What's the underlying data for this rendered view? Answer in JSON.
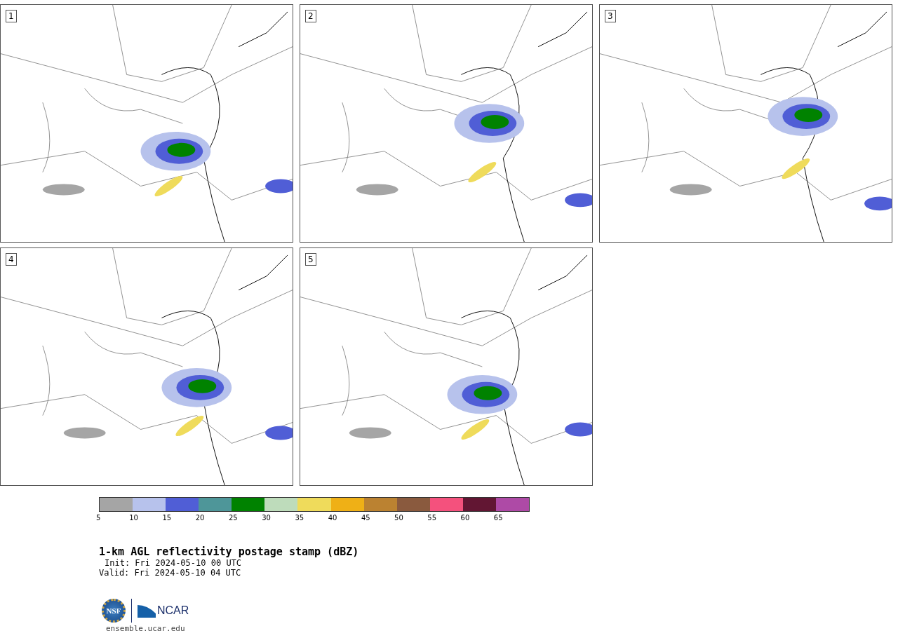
{
  "panels": [
    {
      "label": "1"
    },
    {
      "label": "2"
    },
    {
      "label": "3"
    },
    {
      "label": "4"
    },
    {
      "label": "5"
    }
  ],
  "colorbar": {
    "segments": [
      {
        "label": "5",
        "color": "#a5a5a5"
      },
      {
        "label": "10",
        "color": "#b7c2ec"
      },
      {
        "label": "15",
        "color": "#505ed6"
      },
      {
        "label": "20",
        "color": "#4e9699"
      },
      {
        "label": "25",
        "color": "#008200"
      },
      {
        "label": "30",
        "color": "#bedcbb"
      },
      {
        "label": "35",
        "color": "#efdb5b"
      },
      {
        "label": "40",
        "color": "#efb016"
      },
      {
        "label": "45",
        "color": "#bb8231"
      },
      {
        "label": "50",
        "color": "#8a5a3e"
      },
      {
        "label": "55",
        "color": "#f4517d"
      },
      {
        "label": "60",
        "color": "#621633"
      },
      {
        "label": "65",
        "color": "#ae4aa6"
      }
    ]
  },
  "title": "1-km AGL reflectivity postage stamp (dBZ)",
  "init": "Init: Fri 2024-05-10 00 UTC",
  "valid": "Valid: Fri 2024-05-10 04 UTC",
  "logos": {
    "nsf": "NSF",
    "ncar": "NCAR"
  },
  "footer": "ensemble.ucar.edu"
}
